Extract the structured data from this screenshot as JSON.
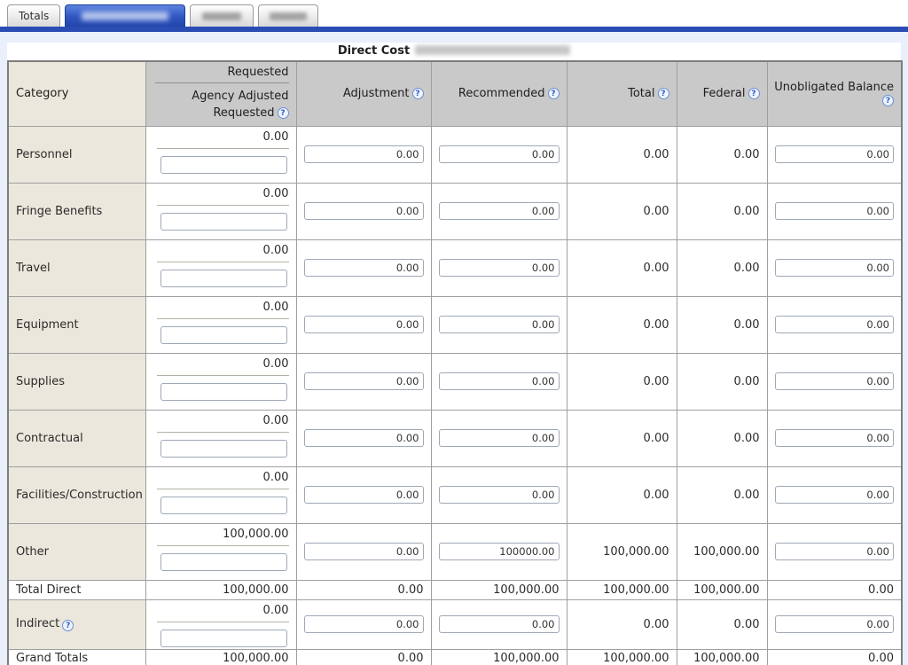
{
  "icons": {
    "help_glyph": "?"
  },
  "tabs": {
    "items": [
      {
        "label": "Totals",
        "active": false,
        "redacted": false
      },
      {
        "label": "",
        "active": true,
        "redacted": true
      },
      {
        "label": "",
        "active": false,
        "redacted": true
      },
      {
        "label": "",
        "active": false,
        "redacted": true
      }
    ]
  },
  "table": {
    "title": "Direct Cost",
    "title_suffix_redacted": true,
    "columns": {
      "category": "Category",
      "requested_top": "Requested",
      "requested_bottom": "Agency Adjusted Requested",
      "adjustment": "Adjustment",
      "recommended": "Recommended",
      "total": "Total",
      "federal": "Federal",
      "unobligated": "Unobligated Balance"
    },
    "rows": [
      {
        "kind": "entry",
        "label": "Personnel",
        "help": false,
        "requested": "0.00",
        "agency_input": "",
        "adjustment_input": "0.00",
        "recommended_input": "0.00",
        "total": "0.00",
        "federal": "0.00",
        "unobligated_input": "0.00"
      },
      {
        "kind": "entry",
        "label": "Fringe Benefits",
        "help": false,
        "requested": "0.00",
        "agency_input": "",
        "adjustment_input": "0.00",
        "recommended_input": "0.00",
        "total": "0.00",
        "federal": "0.00",
        "unobligated_input": "0.00"
      },
      {
        "kind": "entry",
        "label": "Travel",
        "help": false,
        "requested": "0.00",
        "agency_input": "",
        "adjustment_input": "0.00",
        "recommended_input": "0.00",
        "total": "0.00",
        "federal": "0.00",
        "unobligated_input": "0.00"
      },
      {
        "kind": "entry",
        "label": "Equipment",
        "help": false,
        "requested": "0.00",
        "agency_input": "",
        "adjustment_input": "0.00",
        "recommended_input": "0.00",
        "total": "0.00",
        "federal": "0.00",
        "unobligated_input": "0.00"
      },
      {
        "kind": "entry",
        "label": "Supplies",
        "help": false,
        "requested": "0.00",
        "agency_input": "",
        "adjustment_input": "0.00",
        "recommended_input": "0.00",
        "total": "0.00",
        "federal": "0.00",
        "unobligated_input": "0.00"
      },
      {
        "kind": "entry",
        "label": "Contractual",
        "help": false,
        "requested": "0.00",
        "agency_input": "",
        "adjustment_input": "0.00",
        "recommended_input": "0.00",
        "total": "0.00",
        "federal": "0.00",
        "unobligated_input": "0.00"
      },
      {
        "kind": "entry",
        "label": "Facilities/Construction",
        "help": false,
        "requested": "0.00",
        "agency_input": "",
        "adjustment_input": "0.00",
        "recommended_input": "0.00",
        "total": "0.00",
        "federal": "0.00",
        "unobligated_input": "0.00"
      },
      {
        "kind": "entry",
        "label": "Other",
        "help": false,
        "requested": "100,000.00",
        "agency_input": "",
        "adjustment_input": "0.00",
        "recommended_input": "100000.00",
        "total": "100,000.00",
        "federal": "100,000.00",
        "unobligated_input": "0.00"
      },
      {
        "kind": "summary",
        "label": "Total Direct",
        "requested": "100,000.00",
        "adjustment": "0.00",
        "recommended": "100,000.00",
        "total": "100,000.00",
        "federal": "100,000.00",
        "unobligated": "0.00"
      },
      {
        "kind": "entry",
        "short": true,
        "label": "Indirect",
        "help": true,
        "requested": "0.00",
        "agency_input": "",
        "adjustment_input": "0.00",
        "recommended_input": "0.00",
        "total": "0.00",
        "federal": "0.00",
        "unobligated_input": "0.00"
      },
      {
        "kind": "summary",
        "label": "Grand Totals",
        "requested": "100,000.00",
        "adjustment": "0.00",
        "recommended": "100,000.00",
        "total": "100,000.00",
        "federal": "100,000.00",
        "unobligated": "0.00"
      }
    ]
  }
}
